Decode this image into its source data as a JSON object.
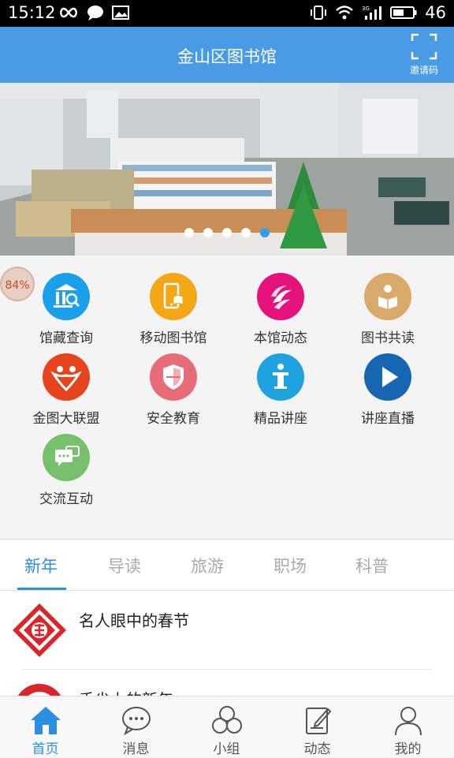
{
  "status_bar": {
    "time": "15:12",
    "battery": "46"
  },
  "app_bar": {
    "title": "金山区图书馆",
    "invite_label": "邀请码"
  },
  "banner": {
    "dot_count": 5,
    "active_dot": 5
  },
  "floating_badge": "84%",
  "features": [
    {
      "label": "馆藏查询",
      "icon": "library-building-icon",
      "color": "#1aa0e8"
    },
    {
      "label": "移动图书馆",
      "icon": "mobile-library-icon",
      "color": "#f4a714"
    },
    {
      "label": "本馆动态",
      "icon": "news-swirl-icon",
      "color": "#e4127a"
    },
    {
      "label": "图书共读",
      "icon": "shared-reading-icon",
      "color": "#d9aa6a"
    },
    {
      "label": "金图大联盟",
      "icon": "alliance-people-icon",
      "color": "#e7431c"
    },
    {
      "label": "安全教育",
      "icon": "shield-icon",
      "color": "#e86b78"
    },
    {
      "label": "精品讲座",
      "icon": "lecture-podium-icon",
      "color": "#1ea3e0"
    },
    {
      "label": "讲座直播",
      "icon": "play-icon",
      "color": "#1666b1"
    },
    {
      "label": "交流互动",
      "icon": "chat-bubbles-icon",
      "color": "#79c06e"
    }
  ],
  "tabs": [
    "新年",
    "导读",
    "旅游",
    "职场",
    "科普"
  ],
  "active_tab": 0,
  "articles": [
    {
      "title": "名人眼中的春节",
      "thumb": "fu-character-papercut"
    },
    {
      "title": "舌尖上的新年",
      "thumb": "red-papercut"
    }
  ],
  "nav": [
    {
      "label": "首页",
      "icon": "home-icon"
    },
    {
      "label": "消息",
      "icon": "message-icon"
    },
    {
      "label": "小组",
      "icon": "group-icon"
    },
    {
      "label": "动态",
      "icon": "edit-note-icon"
    },
    {
      "label": "我的",
      "icon": "profile-icon"
    }
  ],
  "colors": {
    "app_bar": "#4a9be6",
    "accent": "#2a8ee2"
  }
}
